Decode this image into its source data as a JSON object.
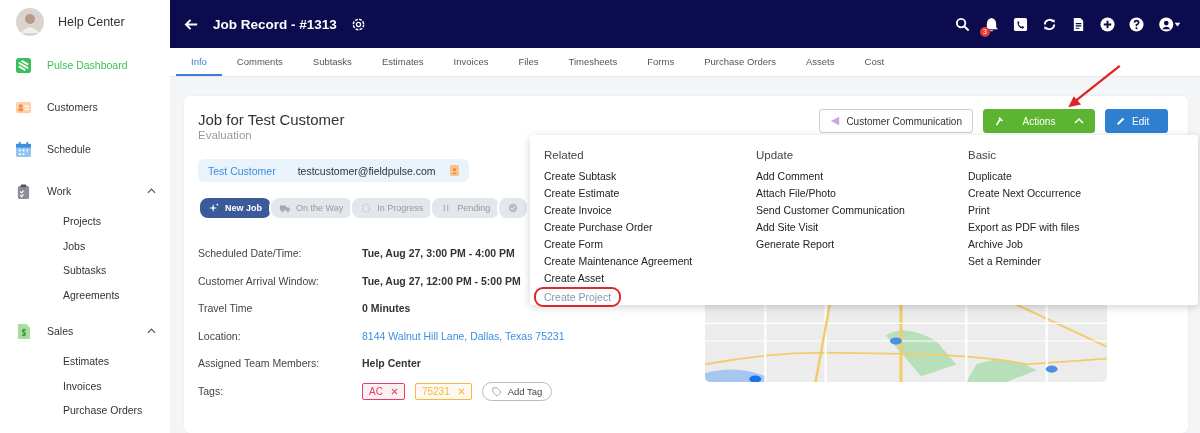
{
  "sidebar": {
    "user": {
      "name": "Help Center"
    },
    "items": [
      {
        "label": "Pulse Dashboard",
        "kind": "pulse",
        "selected": true
      },
      {
        "label": "Customers",
        "kind": "customers",
        "selected": false
      },
      {
        "label": "Schedule",
        "kind": "calendar",
        "selected": false
      },
      {
        "label": "Work",
        "kind": "clipboard",
        "selected": false,
        "expanded": true,
        "children": [
          {
            "label": "Projects"
          },
          {
            "label": "Jobs"
          },
          {
            "label": "Subtasks"
          },
          {
            "label": "Agreements"
          }
        ]
      },
      {
        "label": "Sales",
        "kind": "invoice",
        "selected": false,
        "expanded": true,
        "children": [
          {
            "label": "Estimates"
          },
          {
            "label": "Invoices"
          },
          {
            "label": "Purchase Orders"
          }
        ]
      }
    ]
  },
  "header": {
    "title": "Job Record - #1313",
    "notification_count": "3"
  },
  "tabs": [
    {
      "label": "Info",
      "selected": true
    },
    {
      "label": "Comments",
      "selected": false
    },
    {
      "label": "Subtasks",
      "selected": false
    },
    {
      "label": "Estimates",
      "selected": false
    },
    {
      "label": "Invoices",
      "selected": false
    },
    {
      "label": "Files",
      "selected": false
    },
    {
      "label": "Timesheets",
      "selected": false
    },
    {
      "label": "Forms",
      "selected": false
    },
    {
      "label": "Purchase Orders",
      "selected": false
    },
    {
      "label": "Assets",
      "selected": false
    },
    {
      "label": "Cost",
      "selected": false
    }
  ],
  "job": {
    "title": "Job for Test Customer",
    "subtitle": "Evaluation",
    "customer": "Test Customer",
    "email": "testcustomer@fieldpulse.com",
    "buttons": [
      {
        "label": "Customer Communication",
        "kind": "outline"
      },
      {
        "label": "Actions",
        "kind": "actions"
      },
      {
        "label": "Edit",
        "kind": "edit"
      }
    ],
    "status_steps": [
      {
        "label": "New Job",
        "kind": "new",
        "selected": true
      },
      {
        "label": "On the Way",
        "kind": "truck",
        "selected": false
      },
      {
        "label": "In Progress",
        "kind": "progress",
        "selected": false
      },
      {
        "label": "Pending",
        "kind": "pause",
        "selected": false
      },
      {
        "kind": "check",
        "selected": false
      }
    ],
    "details": [
      {
        "label": "Scheduled Date/Time:",
        "value": "Tue, Aug 27, 3:00 PM - 4:00 PM",
        "kind": "text"
      },
      {
        "label": "Customer Arrival Window:",
        "value": "Tue, Aug 27, 12:00 PM - 5:00 PM",
        "kind": "text"
      },
      {
        "label": "Travel Time",
        "value": "0 Minutes",
        "kind": "text"
      },
      {
        "label": "Location:",
        "value": "8144 Walnut Hill Lane, Dallas, Texas 75231",
        "kind": "link"
      },
      {
        "label": "Assigned Team Members:",
        "value": "Help Center",
        "kind": "text"
      }
    ],
    "tags_label": "Tags:",
    "tags": [
      {
        "label": "AC",
        "color": "#e53e6a"
      },
      {
        "label": "75231",
        "color": "#f5b841"
      }
    ],
    "add_tag": "Add Tag"
  },
  "actions_menu": {
    "columns": [
      {
        "heading": "Related",
        "items": [
          {
            "label": "Create Subtask",
            "highlighted": false
          },
          {
            "label": "Create Estimate",
            "highlighted": false
          },
          {
            "label": "Create Invoice",
            "highlighted": false
          },
          {
            "label": "Create Purchase Order",
            "highlighted": false
          },
          {
            "label": "Create Form",
            "highlighted": false
          },
          {
            "label": "Create Maintenance Agreement",
            "highlighted": false
          },
          {
            "label": "Create Asset",
            "highlighted": false
          },
          {
            "label": "Create Project",
            "highlighted": true
          }
        ]
      },
      {
        "heading": "Update",
        "items": [
          {
            "label": "Add Comment",
            "highlighted": false
          },
          {
            "label": "Attach File/Photo",
            "highlighted": false
          },
          {
            "label": "Send Customer Communication",
            "highlighted": false
          },
          {
            "label": "Add Site Visit",
            "highlighted": false
          },
          {
            "label": "Generate Report",
            "highlighted": false
          }
        ]
      },
      {
        "heading": "Basic",
        "items": [
          {
            "label": "Duplicate",
            "highlighted": false
          },
          {
            "label": "Create Next Occurrence",
            "highlighted": false
          },
          {
            "label": "Print",
            "highlighted": false
          },
          {
            "label": "Export as PDF with files",
            "highlighted": false
          },
          {
            "label": "Archive Job",
            "highlighted": false
          },
          {
            "label": "Set a Reminder",
            "highlighted": false
          }
        ]
      }
    ]
  }
}
